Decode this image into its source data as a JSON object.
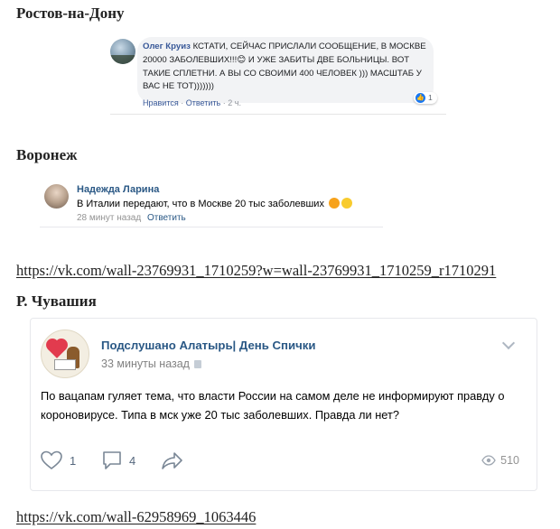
{
  "section1": {
    "heading": "Ростов-на-Дону",
    "comment": {
      "author": "Олег Круиз",
      "text": "КСТАТИ, СЕЙЧАС ПРИСЛАЛИ СООБЩЕНИЕ, В МОСКВЕ 20000 ЗАБОЛЕВШИХ!!!😊 И УЖЕ ЗАБИТЫ ДВЕ БОЛЬНИЦЫ. ВОТ ТАКИЕ СПЛЕТНИ. А ВЫ СО СВОИМИ 400 ЧЕЛОВЕК ))) МАСШТАБ У ВАС НЕ ТОТ)))))))",
      "like_count": "1",
      "actions": {
        "like": "Нравится",
        "separator": "·",
        "reply": "Ответить",
        "time": "2 ч."
      }
    }
  },
  "section2": {
    "heading": "Воронеж",
    "comment": {
      "author": "Надежда Ларина",
      "text": "В Италии передают, что в Москве 20 тыс заболевших",
      "time": "28 минут назад",
      "reply": "Ответить"
    },
    "link": "https://vk.com/wall-23769931_1710259?w=wall-23769931_1710259_r1710291"
  },
  "section3": {
    "heading": "Р. Чувашия",
    "post": {
      "group_name": "Подслушано Алатырь| День Спички",
      "time": "33 минуты назад",
      "text": "По вацапам гуляет тема, что власти России на самом деле не информируют правду о короновирусе. Типа в мск уже 20 тыс заболевших. Правда ли нет?",
      "likes": "1",
      "comments": "4",
      "views": "510"
    },
    "link": "https://vk.com/wall-62958969_1063446"
  },
  "colors": {
    "vk_blue": "#2a5885",
    "fb_blue": "#385898",
    "fb_like": "#1877f2"
  },
  "icons": [
    "heart-icon",
    "comment-icon",
    "share-icon",
    "eye-icon",
    "chevron-down-icon",
    "pin-icon",
    "like-icon"
  ]
}
